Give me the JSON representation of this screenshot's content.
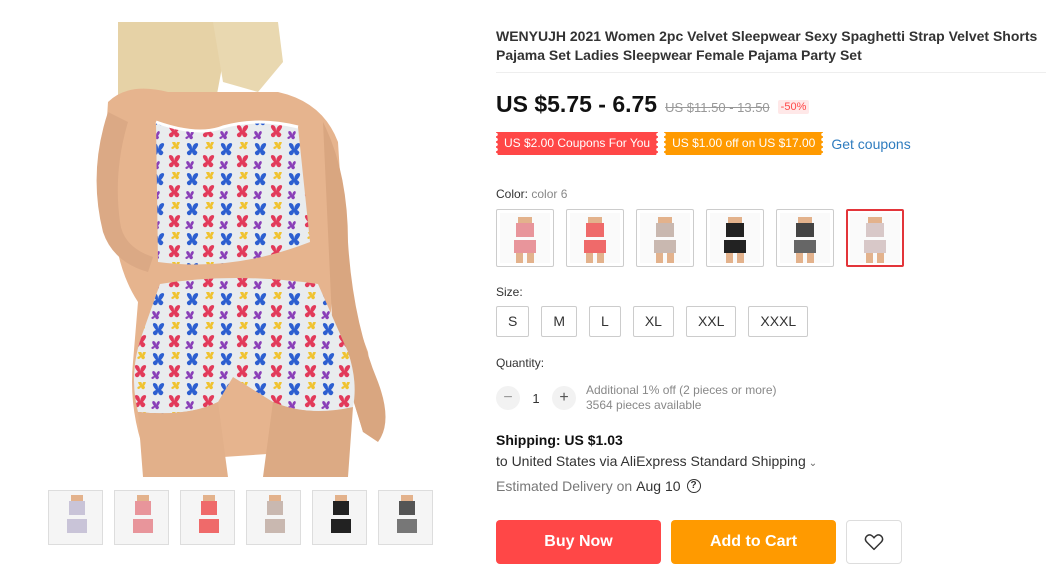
{
  "product": {
    "title": "WENYUJH 2021 Women 2pc Velvet Sleepwear Sexy Spaghetti Strap Velvet Shorts Pajama Set Ladies Sleepwear Female Pajama Party Set",
    "price": "US $5.75 - 6.75",
    "original_price": "US $11.50 - 13.50",
    "discount": "-50%"
  },
  "coupons": {
    "coupon1": "US $2.00 Coupons For You",
    "coupon2": "US $1.00 off on US $17.00",
    "get_link": "Get coupons"
  },
  "color": {
    "label": "Color:",
    "selected": "color 6",
    "options": [
      "color 1",
      "color 2",
      "color 3",
      "color 4",
      "color 5",
      "color 6"
    ],
    "option_colors": [
      "#e8959b",
      "#ef6a6a",
      "#c9b8b0",
      "#222222",
      "#555555",
      "#d8c8c8"
    ]
  },
  "size": {
    "label": "Size:",
    "options": [
      "S",
      "M",
      "L",
      "XL",
      "XXL",
      "XXXL"
    ]
  },
  "quantity": {
    "label": "Quantity:",
    "minus": "−",
    "plus": "+",
    "value": "1",
    "offer": "Additional 1% off (2 pieces or more)",
    "available": "3564 pieces available"
  },
  "shipping": {
    "title": "Shipping: US $1.03",
    "to": "to United States via AliExpress Standard Shipping",
    "delivery_label": "Estimated Delivery on",
    "delivery_date": "Aug 10"
  },
  "actions": {
    "buy_now": "Buy Now",
    "add_to_cart": "Add to Cart"
  },
  "colors": {
    "accent_red": "#ff4747",
    "accent_orange": "#ff9a00",
    "link_blue": "#2e7cbf"
  },
  "icons": {
    "help": "question-circle-icon",
    "wishlist": "heart-icon",
    "dropdown": "chevron-down-icon"
  }
}
